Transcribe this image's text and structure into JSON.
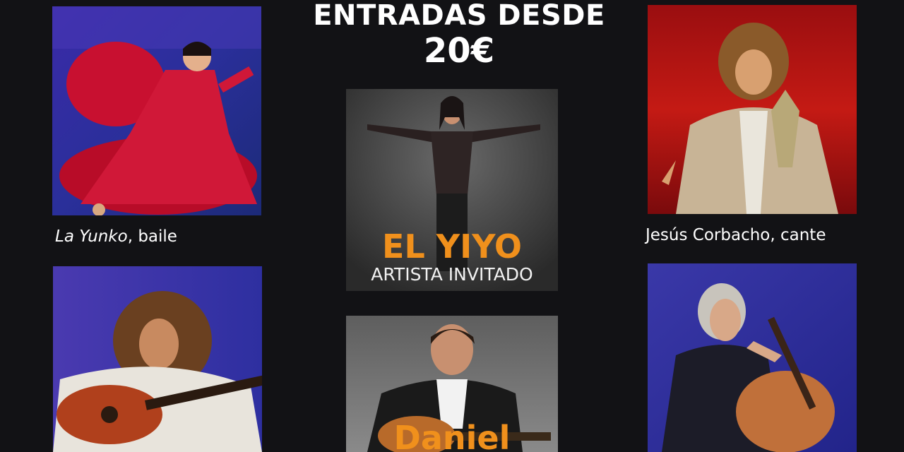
{
  "headline": {
    "line1": "ENTRADAS DESDE",
    "line2": "20€"
  },
  "cards": {
    "la_yunko": {
      "name": "La Yunko",
      "role": ", baile"
    },
    "jesus": {
      "caption": "Jesús Corbacho, cante"
    },
    "yiyo": {
      "name": "EL YIYO",
      "sub": "ARTISTA INVITADO"
    },
    "daniel": {
      "name": "Daniel"
    }
  },
  "colors": {
    "background": "#121215",
    "accent": "#f0901c"
  }
}
